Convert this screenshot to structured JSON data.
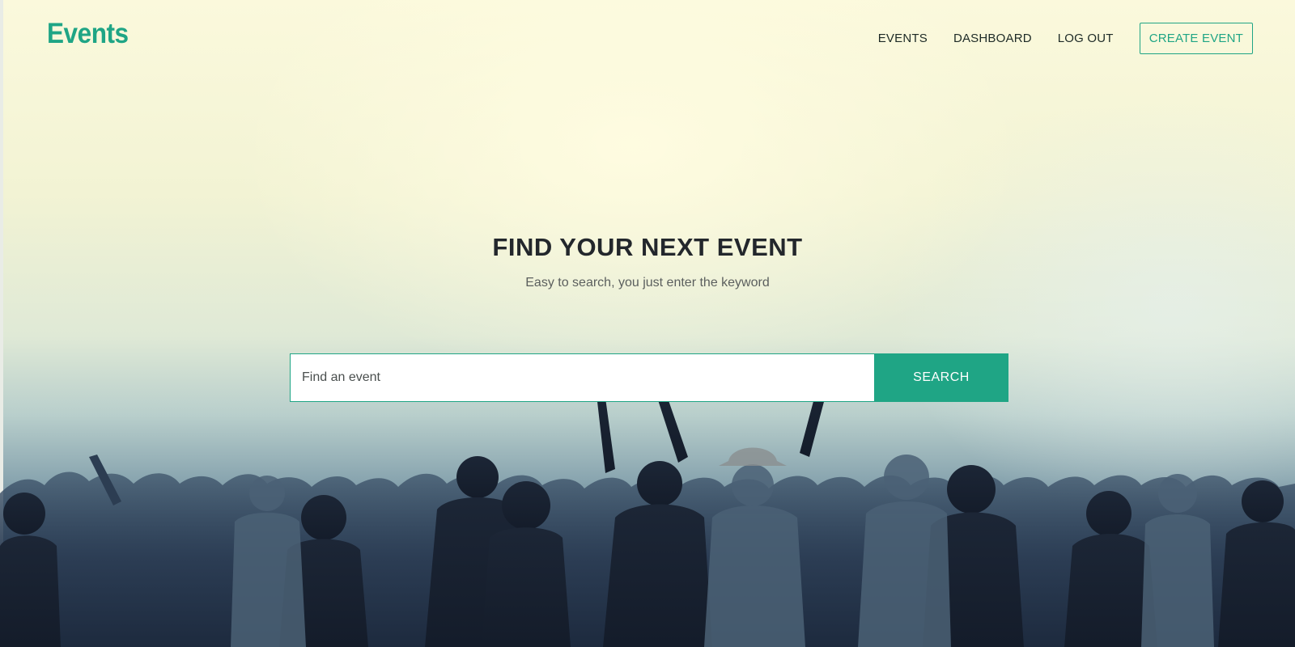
{
  "brand": {
    "name": "Events",
    "accent_color": "#1fa585"
  },
  "nav": {
    "events": "EVENTS",
    "dashboard": "DASHBOARD",
    "logout": "LOG OUT",
    "create_event": "CREATE EVENT"
  },
  "hero": {
    "title": "FIND YOUR NEXT EVENT",
    "subtitle": "Easy to search, you just enter the keyword",
    "background": "concert-crowd-photo"
  },
  "search": {
    "placeholder": "Find an event",
    "button_label": "SEARCH"
  }
}
